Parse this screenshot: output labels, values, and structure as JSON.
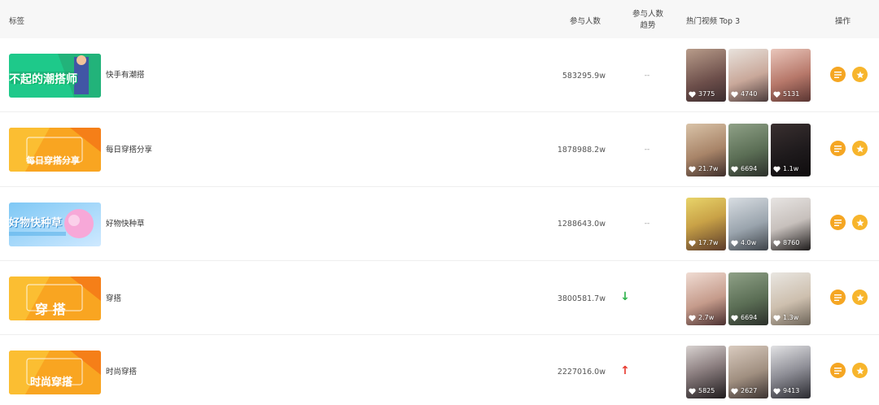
{
  "header": {
    "tag": "标签",
    "participants": "参与人数",
    "trend_line1": "参与人数",
    "trend_line2": "趋势",
    "hot_videos": "热门视频 Top 3",
    "actions": "操作"
  },
  "rows": [
    {
      "thumb_text": "不起的潮搭师",
      "name": "快手有潮搭",
      "count": "583295.9w",
      "trend": "--",
      "videos": [
        {
          "likes": "3775"
        },
        {
          "likes": "4740"
        },
        {
          "likes": "5131"
        }
      ]
    },
    {
      "thumb_text": "每日穿搭分享",
      "name": "每日穿搭分享",
      "count": "1878988.2w",
      "trend": "--",
      "videos": [
        {
          "likes": "21.7w"
        },
        {
          "likes": "6694"
        },
        {
          "likes": "1.1w"
        }
      ]
    },
    {
      "thumb_text": "好物快种草",
      "name": "好物快种草",
      "count": "1288643.0w",
      "trend": "--",
      "videos": [
        {
          "likes": "17.7w"
        },
        {
          "likes": "4.0w"
        },
        {
          "likes": "8760"
        }
      ]
    },
    {
      "thumb_text": "穿 搭",
      "name": "穿搭",
      "count": "3800581.7w",
      "trend": "↓",
      "videos": [
        {
          "likes": "2.7w"
        },
        {
          "likes": "6694"
        },
        {
          "likes": "1.3w"
        }
      ]
    },
    {
      "thumb_text": "时尚穿搭",
      "name": "时尚穿搭",
      "count": "2227016.0w",
      "trend": "↑",
      "videos": [
        {
          "likes": "5825"
        },
        {
          "likes": "2627"
        },
        {
          "likes": "9413"
        }
      ]
    }
  ],
  "colors": {
    "accent_orange": "#f5a623",
    "trend_up": "#e83a2f",
    "trend_down": "#2db34a"
  }
}
